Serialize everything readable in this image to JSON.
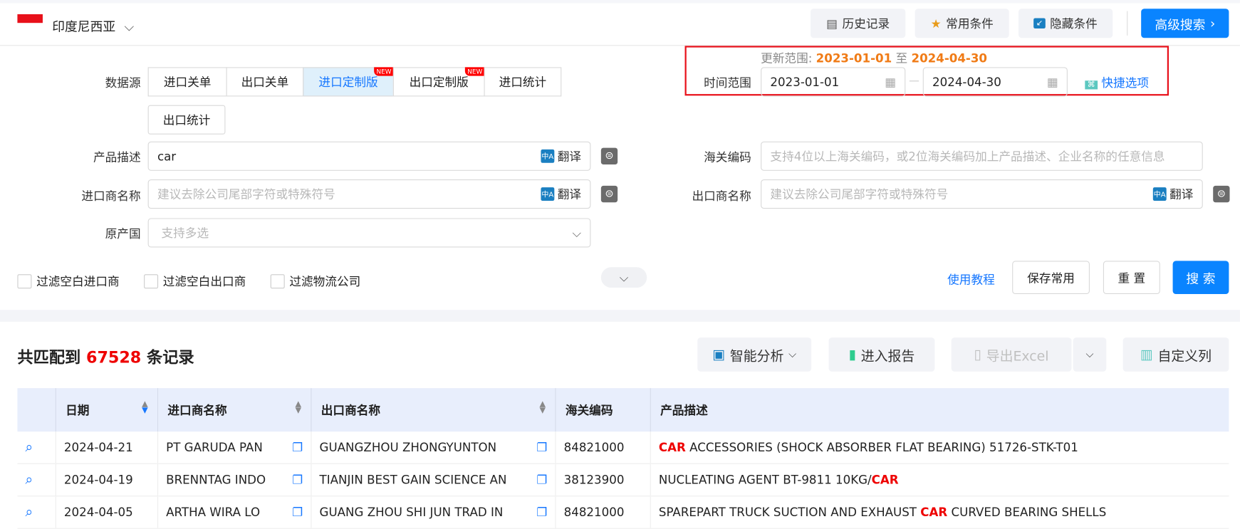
{
  "header": {
    "country": "印度尼西亚",
    "history": "历史记录",
    "common": "常用条件",
    "hide": "隐藏条件",
    "advanced": "高级搜索"
  },
  "time": {
    "update_label": "更新范围:",
    "update_from": "2023-01-01",
    "update_sep": "至",
    "update_to": "2024-04-30",
    "label": "时间范围",
    "from": "2023-01-01",
    "to": "2024-04-30",
    "quick": "快捷选项"
  },
  "datasource": {
    "label": "数据源",
    "tabs": [
      {
        "label": "进口关单"
      },
      {
        "label": "出口关单"
      },
      {
        "label": "进口定制版",
        "badge": "NEW",
        "selected": true
      },
      {
        "label": "出口定制版",
        "badge": "NEW"
      },
      {
        "label": "进口统计"
      },
      {
        "label": "出口统计"
      }
    ]
  },
  "fields": {
    "product": {
      "label": "产品描述",
      "value": "car",
      "translate": "翻译"
    },
    "hscode": {
      "label": "海关编码",
      "placeholder": "支持4位以上海关编码，或2位海关编码加上产品描述、企业名称的任意信息"
    },
    "importer": {
      "label": "进口商名称",
      "placeholder": "建议去除公司尾部字符或特殊符号",
      "translate": "翻译"
    },
    "exporter": {
      "label": "出口商名称",
      "placeholder": "建议去除公司尾部字符或特殊符号",
      "translate": "翻译"
    },
    "origin": {
      "label": "原产国",
      "placeholder": "支持多选"
    }
  },
  "filters": [
    "过滤空白进口商",
    "过滤空白出口商",
    "过滤物流公司"
  ],
  "actions": {
    "tutorial": "使用教程",
    "save": "保存常用",
    "reset": "重 置",
    "search": "搜 索"
  },
  "results": {
    "prefix": "共匹配到",
    "count": "67528",
    "suffix": "条记录",
    "analysis": "智能分析",
    "report": "进入报告",
    "export": "导出Excel",
    "columns_btn": "自定义列"
  },
  "table": {
    "columns": [
      "日期",
      "进口商名称",
      "出口商名称",
      "海关编码",
      "产品描述"
    ],
    "rows": [
      {
        "date": "2024-04-21",
        "importer": "PT GARUDA PAN",
        "exporter": "GUANGZHOU ZHONGYUNTON",
        "hs": "84821000",
        "desc_pre": "",
        "desc_hl": "CAR",
        "desc_post": " ACCESSORIES (SHOCK ABSORBER FLAT BEARING) 51726-STK-T01"
      },
      {
        "date": "2024-04-19",
        "importer": "BRENNTAG INDO",
        "exporter": "TIANJIN BEST GAIN SCIENCE AN",
        "hs": "38123900",
        "desc_pre": "NUCLEATING AGENT BT-9811 10KG/",
        "desc_hl": "CAR",
        "desc_post": ""
      },
      {
        "date": "2024-04-05",
        "importer": "ARTHA WIRA LO",
        "exporter": "GUANG ZHOU SHI JUN TRAD IN",
        "hs": "84821000",
        "desc_pre": "SPAREPART TRUCK SUCTION AND EXHAUST ",
        "desc_hl": "CAR",
        "desc_post": " CURVED BEARING SHELLS"
      }
    ]
  },
  "colors": {
    "accent": "#0a84ff",
    "highlight": "#e00000",
    "update": "#f07b16",
    "box": "#e8101a"
  }
}
